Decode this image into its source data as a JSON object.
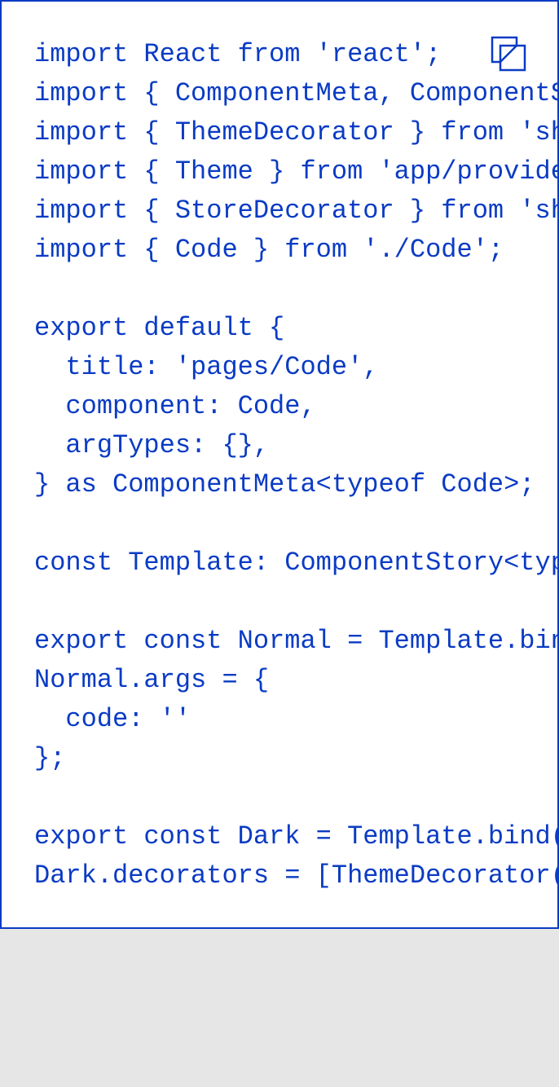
{
  "colors": {
    "code_text": "#0a3bc4",
    "card_border": "#0a3bc4",
    "card_background": "#ffffff",
    "page_background": "#e6e6e6"
  },
  "copy_button": {
    "icon": "copy-icon"
  },
  "code": {
    "lines": [
      "import React from 'react';",
      "import { ComponentMeta, ComponentStory } from '@storybook/react';",
      "import { ThemeDecorator } from 'shared/config/storybook/ThemeDecorator/ThemeDecorator';",
      "import { Theme } from 'app/providers/ThemeProvider';",
      "import { StoreDecorator } from 'shared/config/storybook/StoreDecorator/StoreDecorator';",
      "import { Code } from './Code';",
      "",
      "export default {",
      "  title: 'pages/Code',",
      "  component: Code,",
      "  argTypes: {},",
      "} as ComponentMeta<typeof Code>;",
      "",
      "const Template: ComponentStory<typeof Code> = (args) => <Code {...args} />;",
      "",
      "export const Normal = Template.bind({});",
      "Normal.args = {",
      "  code: ''",
      "};",
      "",
      "export const Dark = Template.bind({});",
      "Dark.decorators = [ThemeDecorator(Theme.DARK)];"
    ]
  }
}
